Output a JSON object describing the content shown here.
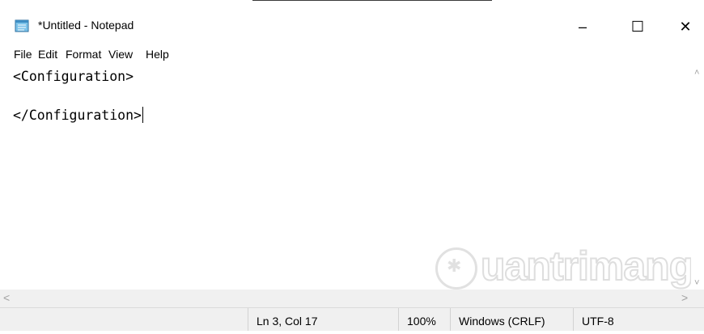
{
  "window": {
    "title": "*Untitled - Notepad",
    "controls": {
      "minimize": "–",
      "maximize": "☐",
      "close": "✕"
    }
  },
  "menu": {
    "items": [
      "File",
      "Edit",
      "Format",
      "View",
      "Help"
    ]
  },
  "editor": {
    "lines": [
      "<Configuration>",
      "",
      "</Configuration>"
    ]
  },
  "scrollbars": {
    "up": "˄",
    "down": "˅",
    "left": "<",
    "right": ">"
  },
  "status": {
    "position": "Ln 3, Col 17",
    "zoom": "100%",
    "line_ending": "Windows (CRLF)",
    "encoding": "UTF-8"
  },
  "watermark": {
    "text": "uantrimang"
  },
  "icons": {
    "app": "notepad-icon",
    "watermark": "lightbulb-icon"
  }
}
